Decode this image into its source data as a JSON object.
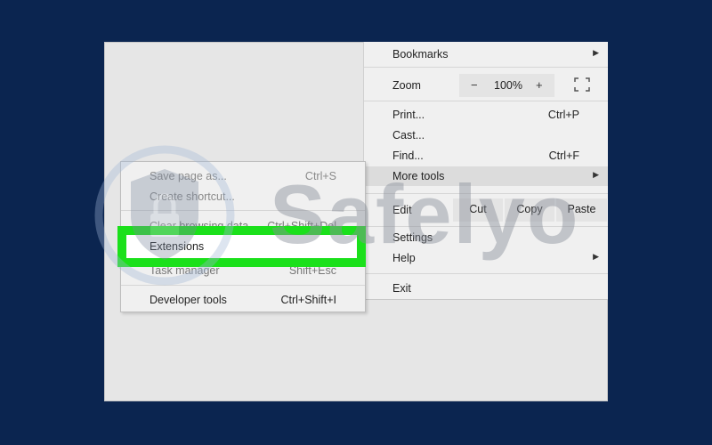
{
  "menu": {
    "bookmarks": {
      "label": "Bookmarks"
    },
    "zoom": {
      "label": "Zoom",
      "minus": "−",
      "level": "100%",
      "plus": "+"
    },
    "print": {
      "label": "Print...",
      "shortcut": "Ctrl+P"
    },
    "cast": {
      "label": "Cast..."
    },
    "find": {
      "label": "Find...",
      "shortcut": "Ctrl+F"
    },
    "more_tools": {
      "label": "More tools"
    },
    "edit": {
      "label": "Edit",
      "cut": "Cut",
      "copy": "Copy",
      "paste": "Paste"
    },
    "settings": {
      "label": "Settings"
    },
    "help": {
      "label": "Help"
    },
    "exit": {
      "label": "Exit"
    }
  },
  "submenu": {
    "save_page": {
      "label": "Save page as...",
      "shortcut": "Ctrl+S"
    },
    "create_shortcut": {
      "label": "Create shortcut..."
    },
    "clear_browsing": {
      "label": "Clear browsing data...",
      "shortcut": "Ctrl+Shift+Del"
    },
    "extensions": {
      "label": "Extensions"
    },
    "task_manager": {
      "label": "Task manager",
      "shortcut": "Shift+Esc"
    },
    "developer_tools": {
      "label": "Developer tools",
      "shortcut": "Ctrl+Shift+I"
    }
  },
  "watermark": {
    "text": "Safelyo"
  },
  "colors": {
    "background": "#0b2550",
    "highlight": "#1be01b"
  },
  "icons": [
    "submenu-arrow-icon",
    "fullscreen-icon",
    "shield-lock-icon"
  ]
}
